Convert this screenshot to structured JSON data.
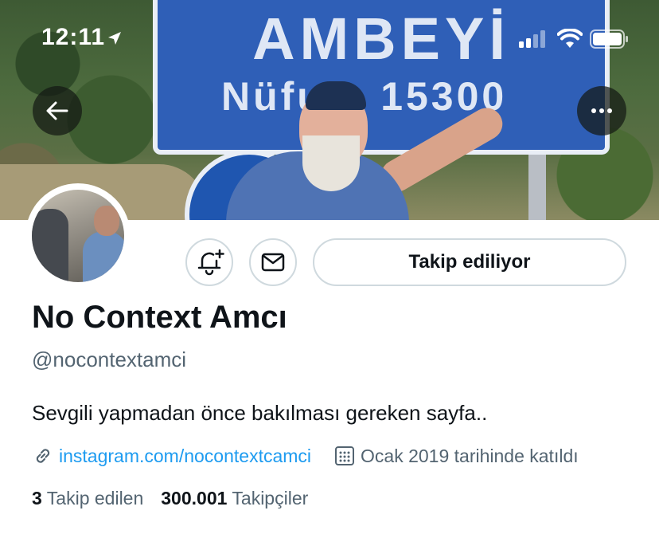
{
  "status_bar": {
    "time": "12:11"
  },
  "banner": {
    "sign_line1": "AMBEYİ",
    "sign_line2": "Nüfus: 15300"
  },
  "header": {
    "back_icon": "arrow-left-icon",
    "more_icon": "more-horizontal-icon"
  },
  "actions": {
    "notify_icon": "bell-plus-icon",
    "message_icon": "envelope-icon",
    "follow_label": "Takip ediliyor"
  },
  "profile": {
    "display_name": "No Context Amcı",
    "handle": "@nocontextamci",
    "bio": "Sevgili yapmadan önce bakılması gereken sayfa..",
    "link": "instagram.com/nocontextcamci",
    "joined": "Ocak 2019 tarihinde katıldı"
  },
  "stats": {
    "following_count": "3",
    "following_label": "Takip edilen",
    "followers_count": "300.001",
    "followers_label": "Takipçiler"
  },
  "colors": {
    "link": "#1d9bf0",
    "text_primary": "#0f1419",
    "text_secondary": "#536471",
    "border": "#cfd9de"
  }
}
